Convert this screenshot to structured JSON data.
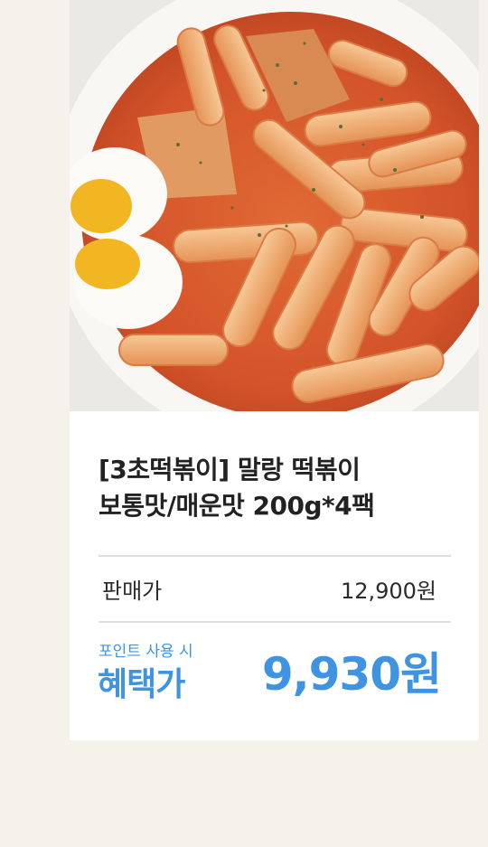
{
  "product": {
    "image_alt": "tteokbokki",
    "title_line1": "[3초떡볶이] 말랑 떡볶이",
    "title_line2": "보통맛/매운맛 200g*4팩",
    "sale_label": "판매가",
    "sale_price": "12,900원",
    "point_note": "포인트 사용 시",
    "benefit_label": "혜택가",
    "benefit_price": "9,930원"
  },
  "colors": {
    "page_bg": "#f4f2ea",
    "card_bg": "#ffffff",
    "accent": "#3e93e3",
    "text": "#222222",
    "divider": "#dedede"
  }
}
